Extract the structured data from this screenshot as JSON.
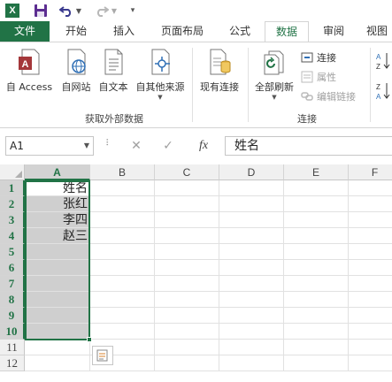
{
  "qat": {
    "logo_letter": "X",
    "icons": [
      "excel-logo-icon",
      "save-icon",
      "undo-icon",
      "redo-icon",
      "customize-qat-icon"
    ]
  },
  "tabs": [
    {
      "label": "文件",
      "kind": "file"
    },
    {
      "label": "开始"
    },
    {
      "label": "插入"
    },
    {
      "label": "页面布局"
    },
    {
      "label": "公式"
    },
    {
      "label": "数据",
      "kind": "active"
    },
    {
      "label": "审阅"
    },
    {
      "label": "视图"
    }
  ],
  "ribbon": {
    "get_external": {
      "group_label": "获取外部数据",
      "buttons": [
        "自 Access",
        "自网站",
        "自文本",
        "自其他来源"
      ]
    },
    "existing_connections": "现有连接",
    "refresh_all": "全部刷新",
    "connections": {
      "group_label": "连接",
      "items": [
        "连接",
        "属性",
        "编辑链接"
      ]
    },
    "sort_az": "A↓Z",
    "sort_za": "Z↓A"
  },
  "formula_bar": {
    "name_box": "A1",
    "cancel_symbol": "✕",
    "enter_symbol": "✓",
    "fx_symbol": "fx",
    "formula": "姓名"
  },
  "grid": {
    "columns": [
      "A",
      "B",
      "C",
      "D",
      "E",
      "F"
    ],
    "selected_column": "A",
    "rows": [
      "1",
      "2",
      "3",
      "4",
      "5",
      "6",
      "7",
      "8",
      "9",
      "10",
      "11",
      "12"
    ],
    "selected_rows": 10,
    "cells_a": [
      "姓名",
      "张红",
      "李四",
      "赵三",
      "",
      "",
      "",
      "",
      "",
      "",
      "",
      ""
    ]
  },
  "colors": {
    "accent": "#217346",
    "selection_fill": "#cfcfcf",
    "header_fill": "#f0f0f0"
  }
}
